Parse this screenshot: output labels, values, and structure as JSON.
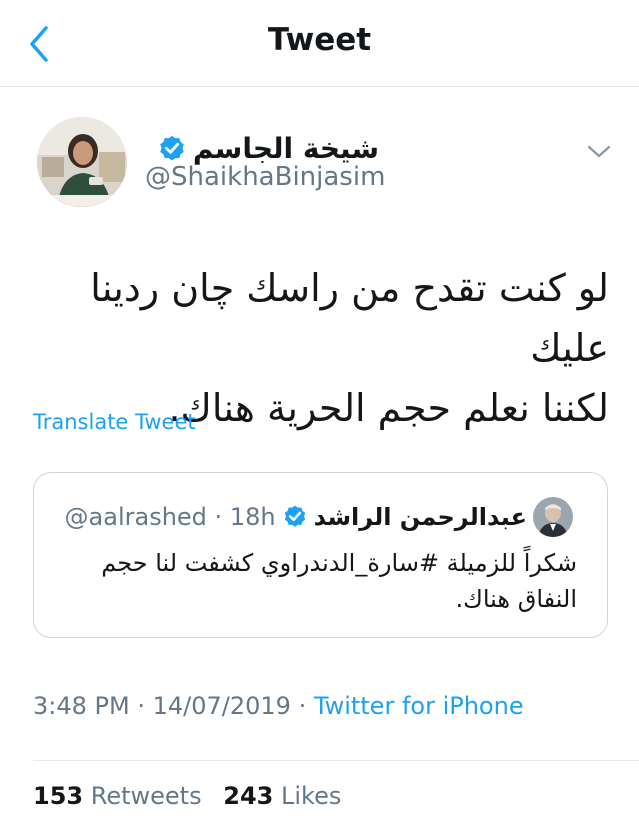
{
  "header": {
    "title": "Tweet"
  },
  "author": {
    "display_name": "شيخة الجاسم",
    "handle": "@ShaikhaBinjasim",
    "verified": true
  },
  "tweet": {
    "lines": [
      "لو كنت تقدح من راسك چان ردينا عليك",
      "لكننا نعلم حجم الحرية هناك."
    ],
    "translate_label": "Translate Tweet"
  },
  "quoted": {
    "display_name": "عبدالرحمن الراشد",
    "handle": "@aalrashed",
    "separator": "·",
    "time": "18h",
    "lines": [
      "شكراً للزميلة #سارة_الدندراوي كشفت لنا حجم",
      "النفاق هناك."
    ]
  },
  "meta": {
    "time": "3:48 PM",
    "separator1": "·",
    "date": "14/07/2019",
    "separator2": "·",
    "source": "Twitter for iPhone"
  },
  "stats": {
    "retweets_count": "153",
    "retweets_label": "Retweets",
    "likes_count": "243",
    "likes_label": "Likes"
  },
  "colors": {
    "accent": "#1da1f2",
    "secondary_text": "#657786",
    "border": "#e1e8ed"
  },
  "icons": {
    "back": "chevron-left-icon",
    "verified": "verified-badge-icon",
    "caret": "chevron-down-icon"
  }
}
